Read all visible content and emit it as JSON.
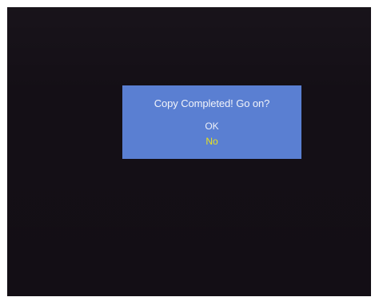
{
  "dialog": {
    "message": "Copy Completed! Go on?",
    "options": [
      {
        "label": "OK",
        "selected": false
      },
      {
        "label": "No",
        "selected": true
      }
    ]
  },
  "colors": {
    "screen_background": "#140f16",
    "dialog_background": "#5a7fd2",
    "text": "#f2f4fa",
    "selected_option": "#e8e21e"
  }
}
